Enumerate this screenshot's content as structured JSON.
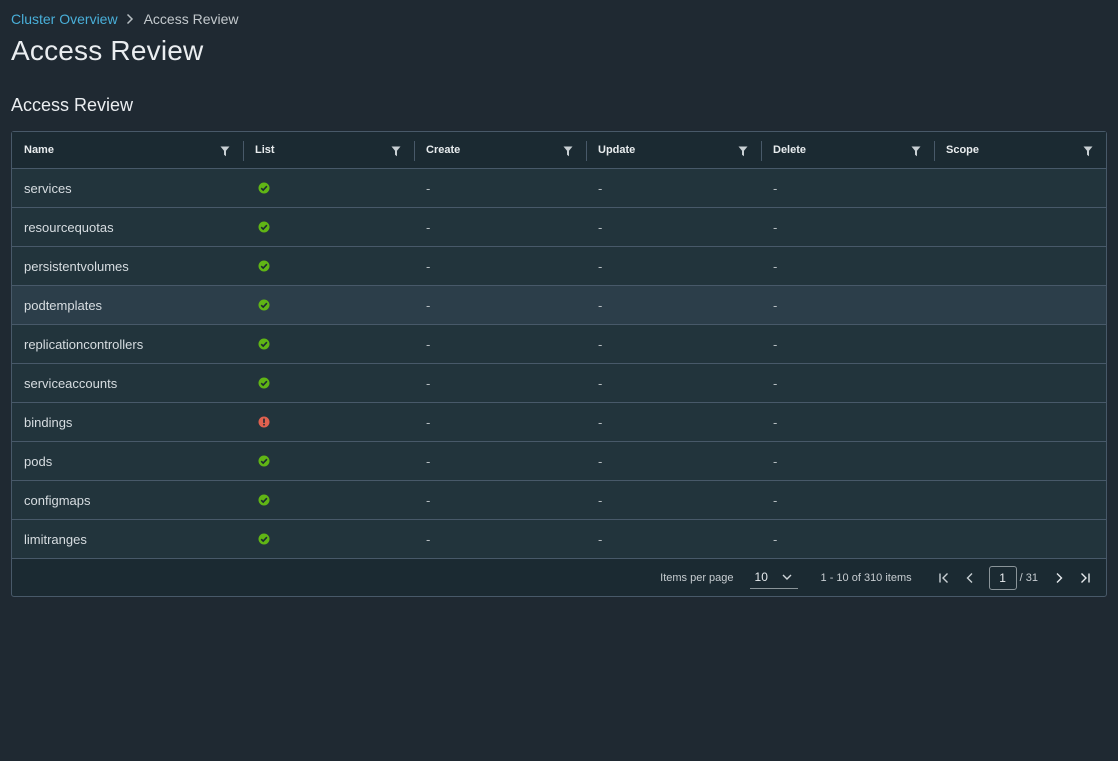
{
  "breadcrumb": {
    "parent": "Cluster Overview",
    "current": "Access Review"
  },
  "page_title": "Access Review",
  "section_title": "Access Review",
  "columns": [
    "Name",
    "List",
    "Create",
    "Update",
    "Delete",
    "Scope"
  ],
  "rows": [
    {
      "name": "services",
      "list": "allowed",
      "create": "-",
      "update": "-",
      "delete": "-",
      "scope": ""
    },
    {
      "name": "resourcequotas",
      "list": "allowed",
      "create": "-",
      "update": "-",
      "delete": "-",
      "scope": ""
    },
    {
      "name": "persistentvolumes",
      "list": "allowed",
      "create": "-",
      "update": "-",
      "delete": "-",
      "scope": ""
    },
    {
      "name": "podtemplates",
      "list": "allowed",
      "create": "-",
      "update": "-",
      "delete": "-",
      "scope": ""
    },
    {
      "name": "replicationcontrollers",
      "list": "allowed",
      "create": "-",
      "update": "-",
      "delete": "-",
      "scope": ""
    },
    {
      "name": "serviceaccounts",
      "list": "allowed",
      "create": "-",
      "update": "-",
      "delete": "-",
      "scope": ""
    },
    {
      "name": "bindings",
      "list": "denied",
      "create": "-",
      "update": "-",
      "delete": "-",
      "scope": ""
    },
    {
      "name": "pods",
      "list": "allowed",
      "create": "-",
      "update": "-",
      "delete": "-",
      "scope": ""
    },
    {
      "name": "configmaps",
      "list": "allowed",
      "create": "-",
      "update": "-",
      "delete": "-",
      "scope": ""
    },
    {
      "name": "limitranges",
      "list": "allowed",
      "create": "-",
      "update": "-",
      "delete": "-",
      "scope": ""
    }
  ],
  "pagination": {
    "items_per_page_label": "Items per page",
    "items_per_page": "10",
    "range_text": "1 - 10 of 310 items",
    "current_page": "1",
    "total_pages": "/ 31"
  },
  "colors": {
    "background": "#1f2932",
    "link": "#49afd9",
    "success": "#60b515",
    "danger": "#e0614f",
    "border": "#485969"
  },
  "icons": {
    "breadcrumb_separator": "chevron-right-icon",
    "filter": "filter-icon",
    "allowed": "check-circle-icon",
    "denied": "exclamation-circle-icon"
  }
}
